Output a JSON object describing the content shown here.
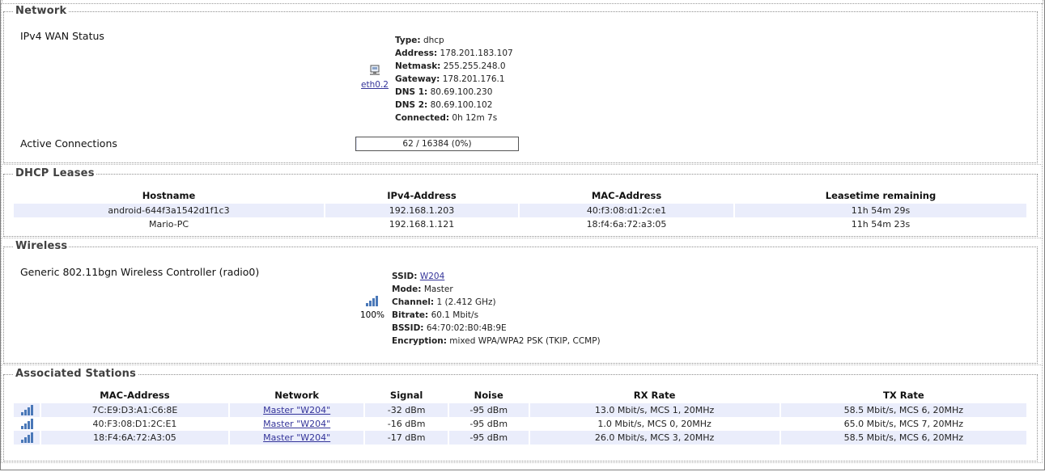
{
  "network": {
    "legend": "Network",
    "wan_label": "IPv4 WAN Status",
    "interface": "eth0.2",
    "wan_info": [
      {
        "key": "Type:",
        "value": "dhcp"
      },
      {
        "key": "Address:",
        "value": "178.201.183.107"
      },
      {
        "key": "Netmask:",
        "value": "255.255.248.0"
      },
      {
        "key": "Gateway:",
        "value": "178.201.176.1"
      },
      {
        "key": "DNS 1:",
        "value": "80.69.100.230"
      },
      {
        "key": "DNS 2:",
        "value": "80.69.100.102"
      },
      {
        "key": "Connected:",
        "value": "0h 12m 7s"
      }
    ],
    "conn_label": "Active Connections",
    "conn_text": "62 / 16384 (0%)",
    "conn_fraction": 0.004
  },
  "dhcp": {
    "legend": "DHCP Leases",
    "headers": [
      "Hostname",
      "IPv4-Address",
      "MAC-Address",
      "Leasetime remaining"
    ],
    "rows": [
      [
        "android-644f3a1542d1f1c3",
        "192.168.1.203",
        "40:f3:08:d1:2c:e1",
        "11h 54m 29s"
      ],
      [
        "Mario-PC",
        "192.168.1.121",
        "18:f4:6a:72:a3:05",
        "11h 54m 23s"
      ]
    ]
  },
  "wireless": {
    "legend": "Wireless",
    "controller": "Generic 802.11bgn Wireless Controller (radio0)",
    "signal_percent_text": "100%",
    "ssid_key": "SSID:",
    "ssid": "W204",
    "info": [
      {
        "key": "Mode:",
        "value": "Master"
      },
      {
        "key": "Channel:",
        "value": "1 (2.412 GHz)"
      },
      {
        "key": "Bitrate:",
        "value": "60.1 Mbit/s"
      },
      {
        "key": "BSSID:",
        "value": "64:70:02:B0:4B:9E"
      },
      {
        "key": "Encryption:",
        "value": "mixed WPA/WPA2 PSK (TKIP, CCMP)"
      }
    ]
  },
  "stations": {
    "legend": "Associated Stations",
    "headers": [
      "",
      "MAC-Address",
      "Network",
      "Signal",
      "Noise",
      "RX Rate",
      "TX Rate"
    ],
    "rows": [
      {
        "mac": "7C:E9:D3:A1:C6:8E",
        "network": "Master \"W204\"",
        "signal": "-32 dBm",
        "noise": "-95 dBm",
        "rx": "13.0 Mbit/s, MCS 1, 20MHz",
        "tx": "58.5 Mbit/s, MCS 6, 20MHz"
      },
      {
        "mac": "40:F3:08:D1:2C:E1",
        "network": "Master \"W204\"",
        "signal": "-16 dBm",
        "noise": "-95 dBm",
        "rx": "1.0 Mbit/s, MCS 0, 20MHz",
        "tx": "65.0 Mbit/s, MCS 7, 20MHz"
      },
      {
        "mac": "18:F4:6A:72:A3:05",
        "network": "Master \"W204\"",
        "signal": "-17 dBm",
        "noise": "-95 dBm",
        "rx": "26.0 Mbit/s, MCS 3, 20MHz",
        "tx": "58.5 Mbit/s, MCS 6, 20MHz"
      }
    ]
  },
  "colors": {
    "row_highlight": "#eaedfb",
    "link": "#333399",
    "signal_bars": "#4a78b8"
  }
}
